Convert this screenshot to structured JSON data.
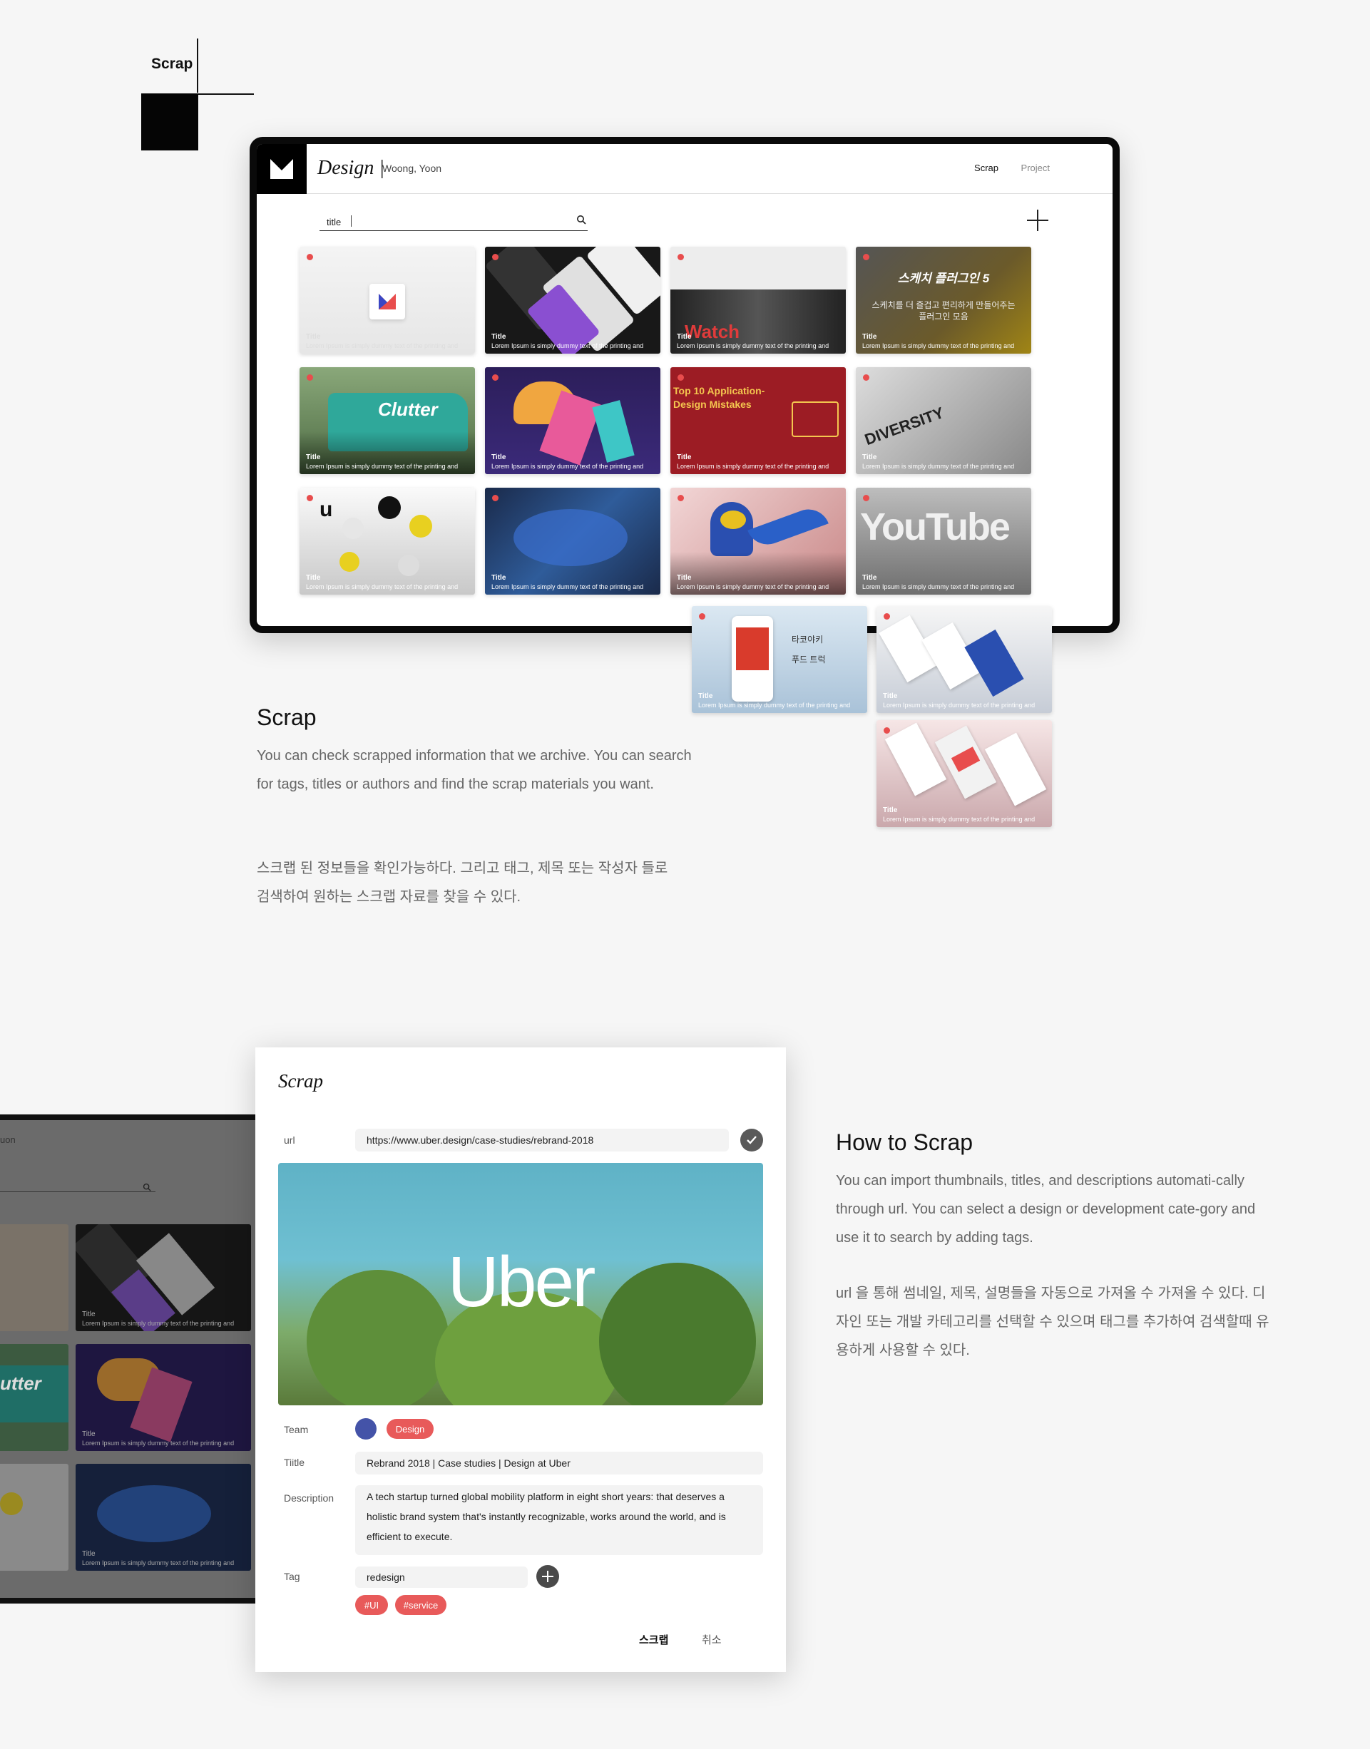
{
  "section": {
    "label": "Scrap"
  },
  "app": {
    "title": "Design |",
    "author": "Woong, Yoon",
    "nav": {
      "scrap": "Scrap",
      "project": "Project"
    },
    "search": {
      "value": "title"
    }
  },
  "cards": [
    {
      "title": "Title",
      "desc": "Lorem Ipsum is simply dummy text of the printing and"
    },
    {
      "title": "Title",
      "desc": "Lorem Ipsum is simply dummy text of the printing and"
    },
    {
      "title": "Title",
      "desc": "Lorem Ipsum is simply dummy text of the printing and",
      "text": "Watch"
    },
    {
      "title": "Title",
      "desc": "Lorem Ipsum is simply dummy text of the printing and",
      "text": "스케치 플러그인 5",
      "sub": "스케치를 더 즐겁고 편리하게 만들어주는 플러그인 모음"
    },
    {
      "title": "Title",
      "desc": "Lorem Ipsum is simply dummy text of the printing and",
      "text": "Clutter"
    },
    {
      "title": "Title",
      "desc": "Lorem Ipsum is simply dummy text of the printing and"
    },
    {
      "title": "Title",
      "desc": "Lorem Ipsum is simply dummy text of the printing and",
      "text": "Top 10 Application-Design Mistakes"
    },
    {
      "title": "Title",
      "desc": "Lorem Ipsum is simply dummy text of the printing and",
      "text": "DIVERSITY"
    },
    {
      "title": "Title",
      "desc": "Lorem Ipsum is simply dummy text of the printing and",
      "text": "u"
    },
    {
      "title": "Title",
      "desc": "Lorem Ipsum is simply dummy text of the printing and"
    },
    {
      "title": "Title",
      "desc": "Lorem Ipsum is simply dummy text of the printing and"
    },
    {
      "title": "Title",
      "desc": "Lorem Ipsum is simply dummy text of the printing and",
      "text": "YouTube"
    },
    {
      "title": "Title",
      "desc": "Lorem Ipsum is simply dummy text of the printing and",
      "text": "타코야키",
      "sub": "푸드 트럭"
    },
    {
      "title": "Title",
      "desc": "Lorem Ipsum is simply dummy text of the printing and"
    },
    {
      "title": "Title",
      "desc": "Lorem Ipsum is simply dummy text of the printing and"
    }
  ],
  "scrap_section": {
    "heading": "Scrap",
    "en": "You can check scrapped information that we archive. You can search for tags, titles or authors and find the scrap materials you want.",
    "ko": "스크랩 된 정보들을 확인가능하다. 그리고 태그, 제목 또는 작성자 들로 검색하여 원하는 스크랩 자료를 찾을 수 있다."
  },
  "howto_section": {
    "heading": "How to Scrap",
    "en": "You can import thumbnails, titles, and descriptions automati-cally through url. You can select a design or development cate-gory and use it to search by adding tags.",
    "ko": "url 을 통해 썸네일, 제목, 설명들을 자동으로 가져올 수 가져올 수 있다. 디자인 또는 개발 카테고리를 선택할 수 있으며 태그를 추가하여 검색할때 유용하게 사용할 수 있다."
  },
  "modal": {
    "title": "Scrap",
    "url_label": "url",
    "url_value": "https://www.uber.design/case-studies/rebrand-2018",
    "preview_text": "Uber",
    "team_label": "Team",
    "team_tag": "Design",
    "title_label": "Tiitle",
    "title_value": "Rebrand 2018 | Case studies | Design at Uber",
    "desc_label": "Description",
    "desc_value": "A tech startup turned global mobility platform in eight  short years: that deserves a holistic brand system that's instantly  recognizable, works around the world, and is efficient to execute.",
    "tag_label": "Tag",
    "tag_value": "redesign",
    "tags": [
      "#UI",
      "#service"
    ],
    "submit": "스크랩",
    "cancel": "취소"
  },
  "bg_device": {
    "author_fragment": "uon",
    "cards_title": "Title",
    "cards_desc": "Lorem Ipsum is simply dummy text of the printing and",
    "clutter_fragment": "utter"
  },
  "colors": {
    "accent": "#e85a5a",
    "team": "#4453a8",
    "frame": "#0a0a0a",
    "bg": "#f6f6f6"
  }
}
